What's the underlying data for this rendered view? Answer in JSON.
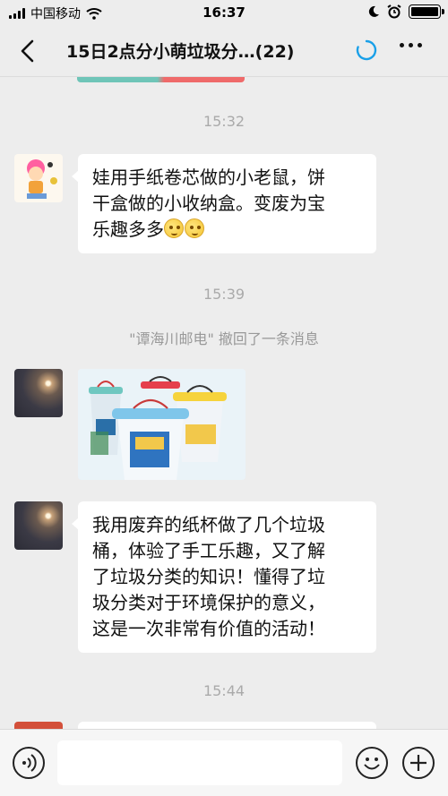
{
  "status_bar": {
    "carrier": "中国移动",
    "time": "16:37"
  },
  "nav": {
    "title": "15日2点分小萌垃圾分…(22)",
    "back_icon": "chevron-left-icon",
    "loading_icon": "loading-spinner-icon",
    "more_icon": "more-dots-icon"
  },
  "messages": [
    {
      "time": "15:32"
    },
    {
      "text_line1": "娃用手纸卷芯做的小老鼠，饼",
      "text_line2": "干盒做的小收纳盒。变废为宝",
      "text_line3": "乐趣多多"
    },
    {
      "time": "15:39"
    },
    {
      "system": "\"谭海川邮电\" 撤回了一条消息"
    },
    {
      "photo_caption": ""
    },
    {
      "lines": [
        "我用废弃的纸杯做了几个垃圾",
        "桶，体验了手工乐趣，又了解",
        "了垃圾分类的知识！懂得了垃",
        "圾分类对于环境保护的意义，",
        "这是一次非常有价值的活动！"
      ]
    },
    {
      "time": "15:44"
    }
  ],
  "input_bar": {
    "voice_icon": "voice-icon",
    "emoji_icon": "emoji-icon",
    "plus_icon": "plus-icon"
  },
  "colors": {
    "background": "#ededed",
    "bubble": "#ffffff",
    "accent": "#1aa0e8"
  }
}
